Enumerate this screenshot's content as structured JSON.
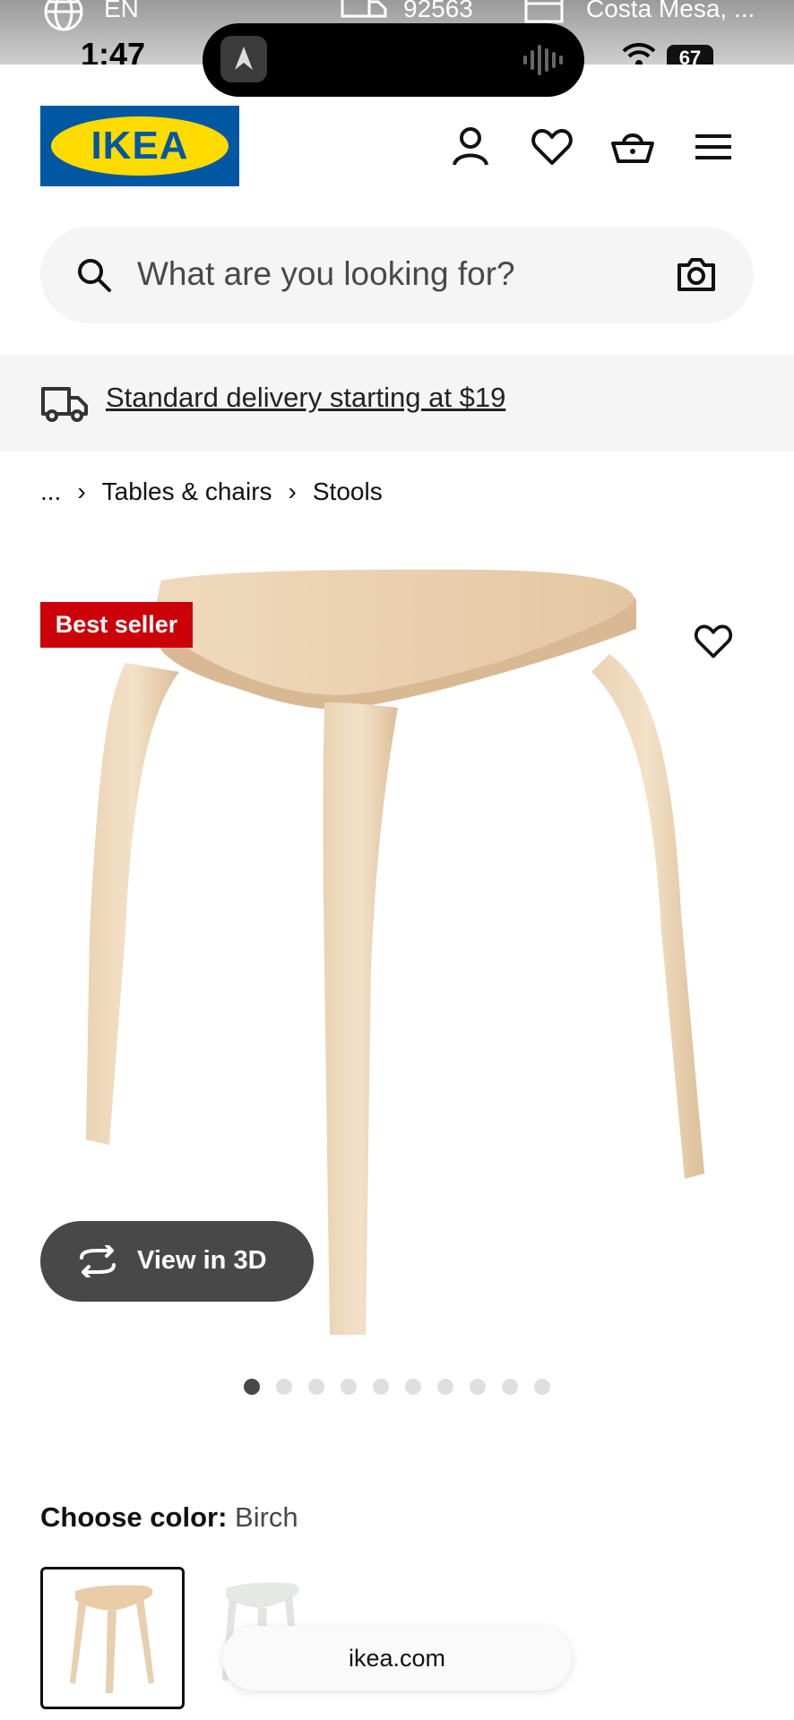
{
  "status_bar": {
    "language": "EN",
    "zip": "92563",
    "location": "Costa Mesa, ...",
    "time": "1:47",
    "battery": "67"
  },
  "header": {
    "logo_text": "IKEA",
    "icons": [
      "account-icon",
      "heart-icon",
      "cart-icon",
      "menu-icon"
    ]
  },
  "search": {
    "placeholder": "What are you looking for?"
  },
  "delivery_banner": {
    "text": "Standard delivery starting at $19"
  },
  "breadcrumb": {
    "items": [
      "...",
      "Tables & chairs",
      "Stools"
    ]
  },
  "product": {
    "badge": "Best seller",
    "view3d_label": "View in 3D",
    "image_count": 10,
    "active_image": 1
  },
  "color": {
    "label": "Choose color:",
    "value": "Birch"
  },
  "browser": {
    "url": "ikea.com"
  },
  "colors": {
    "ikea_blue": "#0058a3",
    "ikea_yellow": "#ffdb00",
    "badge_red": "#cc0008",
    "dark_gray": "#484848"
  }
}
